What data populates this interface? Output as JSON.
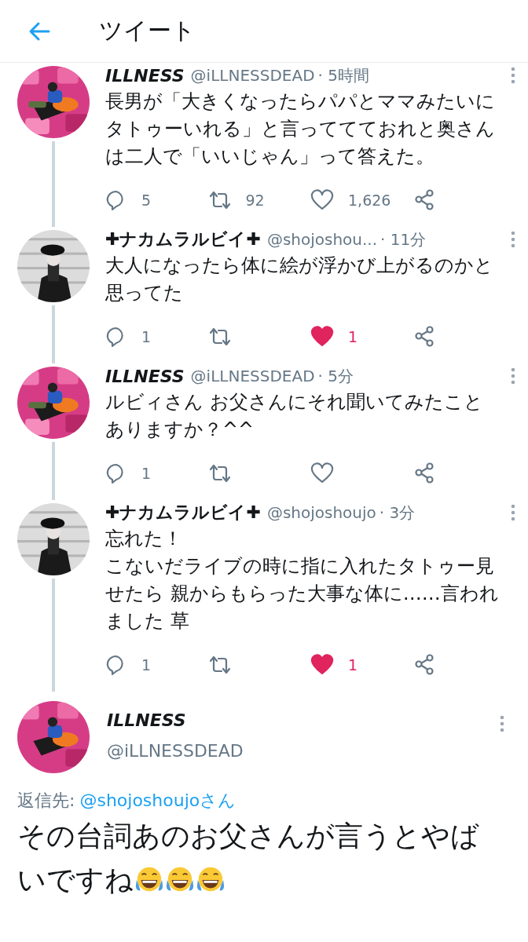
{
  "header": {
    "title": "ツイート"
  },
  "tweets": [
    {
      "name": "ILLNESS",
      "handle": "@iLLNESSDEAD",
      "time": "· 5時間",
      "paragraphs": [
        "長男が「大きくなったらパパとママみたいにタトゥーいれる」と言っててておれと奥さんは二人で「いいじゃん」って答えた。"
      ],
      "replies": "5",
      "retweets": "92",
      "likes": "1,626",
      "liked": false
    },
    {
      "name": "✚ナカムラルビイ✚",
      "handle": "@shojoshou...",
      "time": "· 11分",
      "paragraphs": [
        "大人になったら体に絵が浮かび上がるのかと思ってた"
      ],
      "replies": "1",
      "likes": "1",
      "liked": true
    },
    {
      "name": "ILLNESS",
      "handle": "@iLLNESSDEAD",
      "time": "· 5分",
      "paragraphs": [
        "ルビィさん お父さんにそれ聞いてみたことありますか？^^"
      ],
      "replies": "1",
      "liked": false
    },
    {
      "name": "✚ナカムラルビイ✚",
      "handle": "@shojoshoujo",
      "time": "· 3分",
      "paragraphs": [
        "忘れた！",
        "こないだライブの時に指に入れたタトゥー見せたら 親からもらった大事な体に……言われました 草"
      ],
      "replies": "1",
      "likes": "1",
      "liked": true
    }
  ],
  "main": {
    "name": "ILLNESS",
    "handle": "@iLLNESSDEAD",
    "reply_label": "返信先:",
    "reply_to": "@shojoshoujoさん",
    "lines": [
      "その台詞あのお父さんが言うとやば",
      "いですね"
    ]
  }
}
